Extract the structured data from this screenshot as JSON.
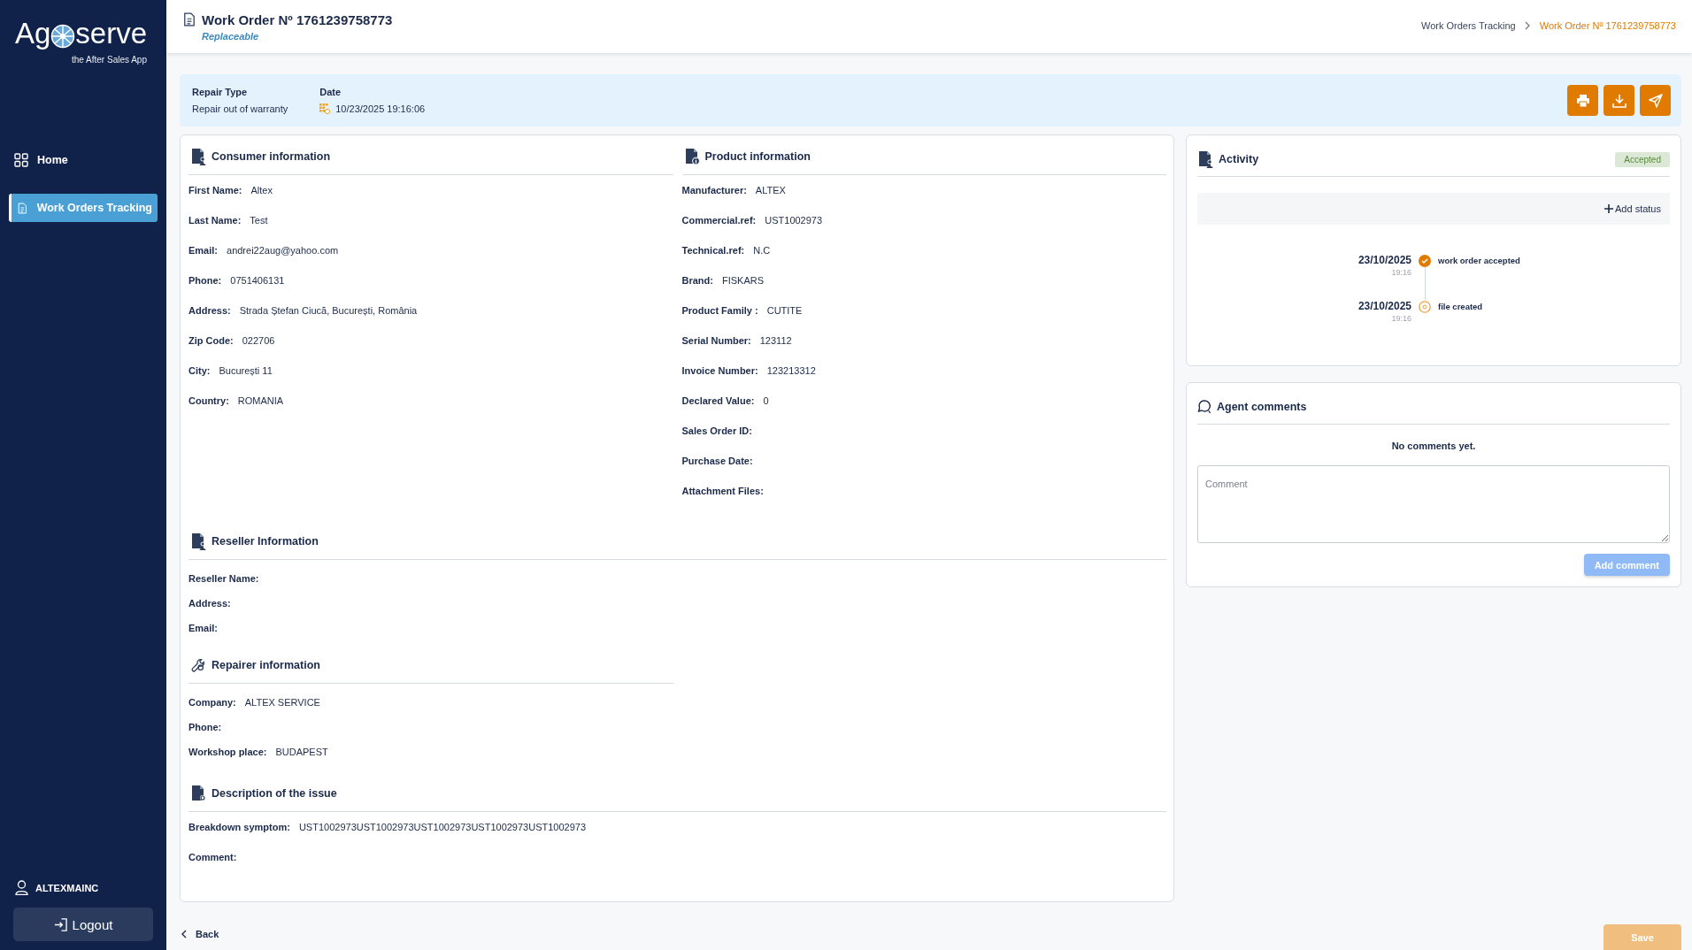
{
  "logo": {
    "before": "Ag",
    "after": "serve",
    "tagline": "the After Sales App"
  },
  "sidebar": {
    "items": [
      {
        "label": "Home",
        "selected": false
      },
      {
        "label": "Work Orders Tracking",
        "selected": true
      }
    ],
    "user": "ALTEXMAINC",
    "logout": "Logout"
  },
  "header": {
    "title": "Work Order Nº 1761239758773",
    "subtitle": "Replaceable",
    "breadcrumb": [
      "Work Orders Tracking",
      "Work Order Nº 1761239758773"
    ]
  },
  "summary": {
    "repair_type_label": "Repair Type",
    "repair_type": "Repair out of warranty",
    "date_label": "Date",
    "date": "10/23/2025 19:16:06"
  },
  "consumer": {
    "title": "Consumer information",
    "fields": [
      {
        "label": "First Name:",
        "value": "Altex"
      },
      {
        "label": "Last Name:",
        "value": "Test"
      },
      {
        "label": "Email:",
        "value": "andrei22aug@yahoo.com"
      },
      {
        "label": "Phone:",
        "value": "0751406131"
      },
      {
        "label": "Address:",
        "value": "Strada Ștefan Ciucă, București, România"
      },
      {
        "label": "Zip Code:",
        "value": "022706"
      },
      {
        "label": "City:",
        "value": "București 11"
      },
      {
        "label": "Country:",
        "value": "ROMANIA"
      }
    ]
  },
  "product": {
    "title": "Product information",
    "fields": [
      {
        "label": "Manufacturer:",
        "value": "ALTEX"
      },
      {
        "label": "Commercial.ref:",
        "value": "UST1002973"
      },
      {
        "label": "Technical.ref:",
        "value": "N.C"
      },
      {
        "label": "Brand:",
        "value": "FISKARS"
      },
      {
        "label": "Product Family :",
        "value": "CUTITE"
      },
      {
        "label": "Serial Number:",
        "value": "123112"
      },
      {
        "label": "Invoice Number:",
        "value": "123213312"
      },
      {
        "label": "Declared Value:",
        "value": "0"
      },
      {
        "label": "Sales Order ID:"
      },
      {
        "label": "Purchase Date:"
      },
      {
        "label": "Attachment Files:"
      }
    ]
  },
  "reseller": {
    "title": "Reseller Information",
    "fields": [
      {
        "label": "Reseller Name:"
      },
      {
        "label": "Address:"
      },
      {
        "label": "Email:"
      }
    ]
  },
  "repairer": {
    "title": "Repairer information",
    "fields": [
      {
        "label": "Company:",
        "value": "ALTEX SERVICE"
      },
      {
        "label": "Phone:"
      },
      {
        "label": "Workshop place:",
        "value": "BUDAPEST"
      }
    ]
  },
  "issue": {
    "title": "Description of the issue",
    "fields": [
      {
        "label": "Breakdown symptom:",
        "value": "UST1002973UST1002973UST1002973UST1002973UST1002973"
      },
      {
        "label": "Comment:"
      }
    ]
  },
  "activity": {
    "title": "Activity",
    "status": "Accepted",
    "add_status": "Add status",
    "events": [
      {
        "kind": "done",
        "date": "23/10/2025",
        "time": "19:16",
        "text": "work order accepted"
      },
      {
        "kind": "created",
        "date": "23/10/2025",
        "time": "19:16",
        "text": "file created"
      }
    ]
  },
  "comments": {
    "title": "Agent comments",
    "empty": "No comments yet.",
    "placeholder": "Comment",
    "button": "Add comment",
    "disabled": true
  },
  "back": "Back",
  "save": {
    "label": "Save",
    "disabled": true
  }
}
